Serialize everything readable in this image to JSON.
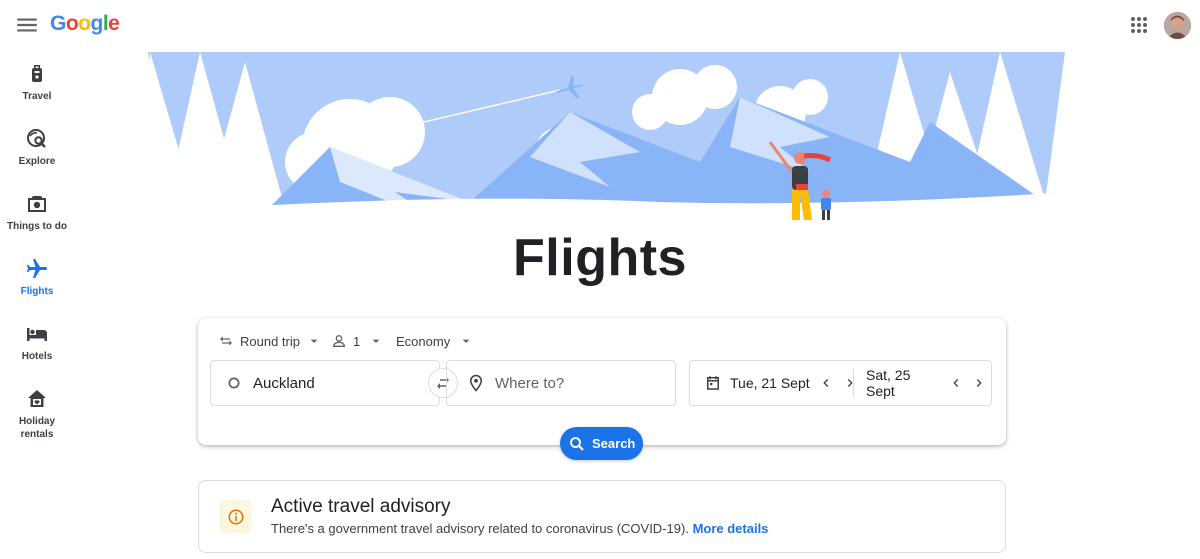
{
  "header": {
    "logo_text": "Google",
    "menu_icon": "menu-icon",
    "apps_icon": "apps-grid-icon"
  },
  "sidebar": {
    "items": [
      {
        "label": "Travel",
        "icon": "suitcase-icon"
      },
      {
        "label": "Explore",
        "icon": "explore-icon"
      },
      {
        "label": "Things to do",
        "icon": "camera-icon"
      },
      {
        "label": "Flights",
        "icon": "plane-icon",
        "active": true
      },
      {
        "label": "Hotels",
        "icon": "bed-icon"
      },
      {
        "label": "Holiday rentals",
        "icon": "house-icon"
      }
    ]
  },
  "hero": {
    "title": "Flights"
  },
  "search": {
    "trip_type": "Round trip",
    "passengers": "1",
    "cabin_class": "Economy",
    "origin_value": "Auckland",
    "destination_placeholder": "Where to?",
    "departure_date": "Tue, 21 Sept",
    "return_date": "Sat, 25 Sept",
    "search_label": "Search"
  },
  "advisory": {
    "title": "Active travel advisory",
    "text": "There's a government travel advisory related to coronavirus (COVID-19).",
    "link": "More details"
  },
  "colors": {
    "accent": "#1a73e8",
    "hero_blue": "#aecbfa",
    "advisory_bg": "#fef7e0"
  }
}
